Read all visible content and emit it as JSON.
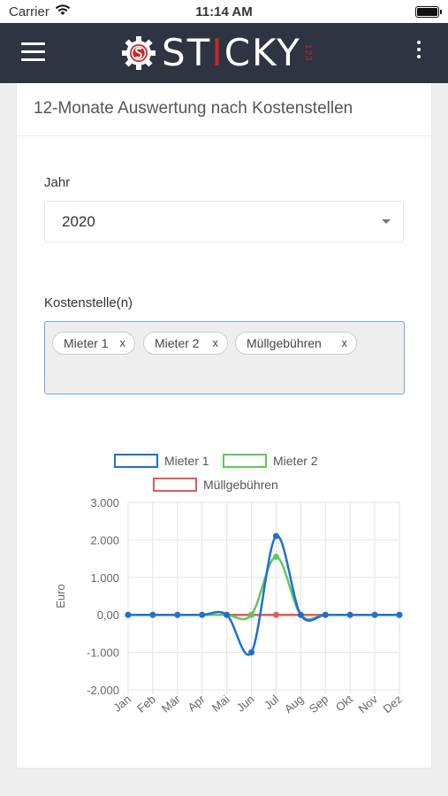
{
  "status": {
    "carrier": "Carrier",
    "time": "11:14 AM"
  },
  "app": {
    "logo_word_a": "ST",
    "logo_word_b": "I",
    "logo_word_c": "CKY",
    "logo_suffix": "123"
  },
  "page": {
    "title": "12-Monate Auswertung nach Kostenstellen",
    "year_label": "Jahr",
    "year_value": "2020",
    "cost_label": "Kostenstelle(n)",
    "tags": [
      {
        "label": "Mieter 1",
        "remove": "x"
      },
      {
        "label": "Mieter 2",
        "remove": "x"
      },
      {
        "label": "Müllgebühren",
        "remove": "x"
      }
    ]
  },
  "chart_data": {
    "type": "line",
    "categories": [
      "Jan",
      "Feb",
      "Mär",
      "Apr",
      "Mai",
      "Jun",
      "Jul",
      "Aug",
      "Sep",
      "Okt",
      "Nov",
      "Dez"
    ],
    "series": [
      {
        "name": "Mieter 1",
        "color": "#1f6fd6",
        "values": [
          0,
          0,
          0,
          0,
          0,
          -1000,
          2100,
          0,
          0,
          0,
          0,
          0
        ]
      },
      {
        "name": "Mieter 2",
        "color": "#5cc85c",
        "values": [
          0,
          0,
          0,
          0,
          0,
          0,
          1550,
          0,
          0,
          0,
          0,
          0
        ]
      },
      {
        "name": "Müllgebühren",
        "color": "#e05a5a",
        "values": [
          0,
          0,
          0,
          0,
          0,
          0,
          0,
          0,
          0,
          0,
          0,
          0
        ]
      }
    ],
    "ylabel": "Euro",
    "ylim": [
      -2000,
      3000
    ],
    "yticks": [
      "3.000",
      "2.000",
      "1.000",
      "0,00",
      "-1.000",
      "-2.000"
    ],
    "grid": true,
    "legend": "top"
  }
}
